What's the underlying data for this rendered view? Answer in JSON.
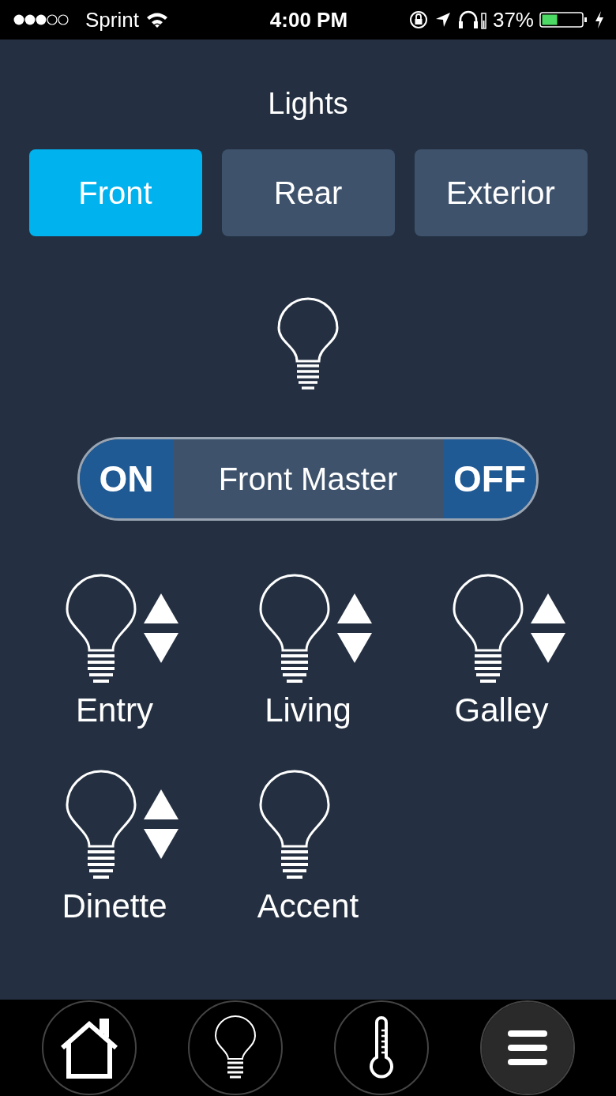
{
  "status_bar": {
    "carrier": "Sprint",
    "time": "4:00 PM",
    "battery": "37%"
  },
  "title": "Lights",
  "tabs": [
    {
      "label": "Front",
      "selected": true
    },
    {
      "label": "Rear",
      "selected": false
    },
    {
      "label": "Exterior",
      "selected": false
    }
  ],
  "master": {
    "on_label": "ON",
    "name": "Front Master",
    "off_label": "OFF"
  },
  "lights": [
    {
      "name": "Entry",
      "kind": "dimmer"
    },
    {
      "name": "Living",
      "kind": "dimmer"
    },
    {
      "name": "Galley",
      "kind": "dimmer"
    },
    {
      "name": "Dinette",
      "kind": "dimmer"
    },
    {
      "name": "Accent",
      "kind": "switch"
    }
  ],
  "nav": [
    {
      "kind": "home",
      "selected": false
    },
    {
      "kind": "bulb",
      "selected": false
    },
    {
      "kind": "thermometer",
      "selected": false
    },
    {
      "kind": "menu",
      "selected": true
    }
  ]
}
